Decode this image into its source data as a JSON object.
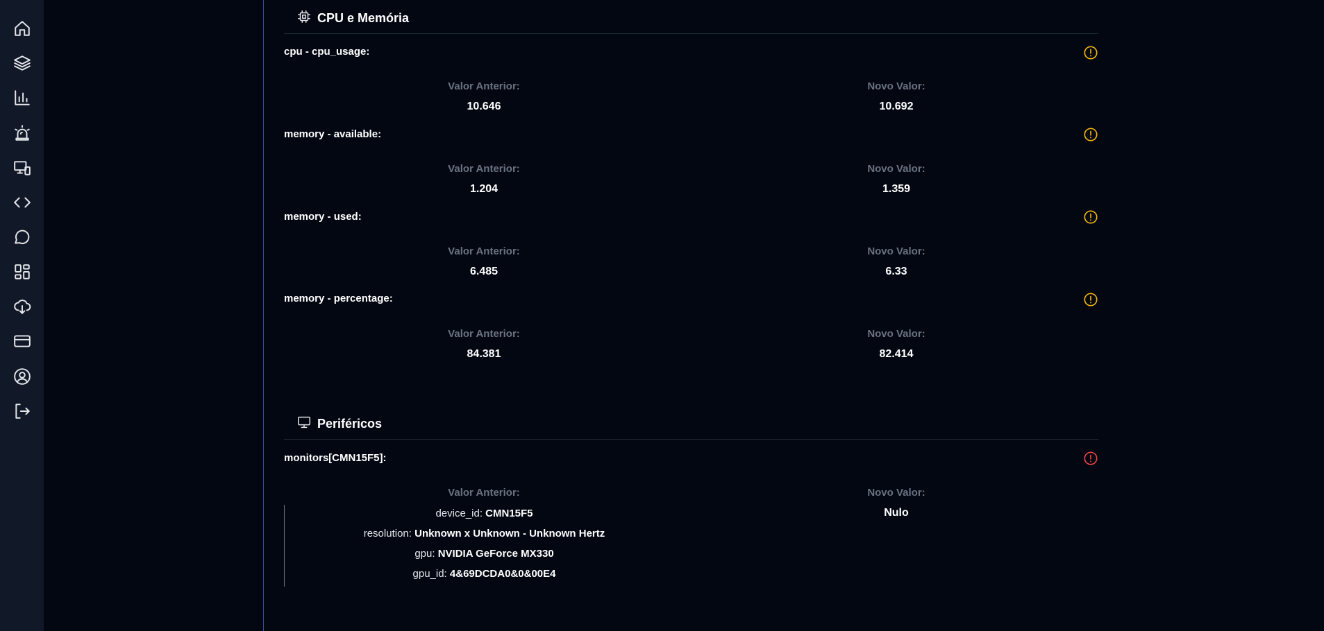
{
  "sidebar": {
    "items": [
      {
        "icon": "home-icon"
      },
      {
        "icon": "layers-icon"
      },
      {
        "icon": "bar-chart-icon"
      },
      {
        "icon": "alarm-siren-icon"
      },
      {
        "icon": "devices-icon"
      },
      {
        "icon": "code-icon"
      },
      {
        "icon": "chat-bubble-icon"
      },
      {
        "icon": "dashboard-grid-icon"
      },
      {
        "icon": "cloud-download-icon"
      },
      {
        "icon": "credit-card-icon"
      },
      {
        "icon": "user-circle-icon"
      },
      {
        "icon": "logout-icon"
      }
    ]
  },
  "colors": {
    "background": "#030712",
    "sidebar": "#111827",
    "warning": "#f5b70a",
    "error": "#ef4444",
    "muted": "#6b7280"
  },
  "cpu_section": {
    "title": "CPU e Memória",
    "metrics": [
      {
        "label": "cpu - cpu_usage:",
        "status": "warning",
        "prev_title": "Valor Anterior:",
        "prev_value": "10.646",
        "new_title": "Novo Valor:",
        "new_value": "10.692"
      },
      {
        "label": "memory - available:",
        "status": "warning",
        "prev_title": "Valor Anterior:",
        "prev_value": "1.204",
        "new_title": "Novo Valor:",
        "new_value": "1.359"
      },
      {
        "label": "memory - used:",
        "status": "warning",
        "prev_title": "Valor Anterior:",
        "prev_value": "6.485",
        "new_title": "Novo Valor:",
        "new_value": "6.33"
      },
      {
        "label": "memory - percentage:",
        "status": "warning",
        "prev_title": "Valor Anterior:",
        "prev_value": "84.381",
        "new_title": "Novo Valor:",
        "new_value": "82.414"
      }
    ]
  },
  "peripherals_section": {
    "title": "Periféricos",
    "metric": {
      "label": "monitors[CMN15F5]:",
      "status": "error",
      "prev_title": "Valor Anterior:",
      "prev_lines": [
        {
          "key": "device_id:",
          "value": "CMN15F5"
        },
        {
          "key": "resolution:",
          "value": "Unknown x Unknown - Unknown Hertz"
        },
        {
          "key": "gpu:",
          "value": "NVIDIA GeForce MX330"
        },
        {
          "key": "gpu_id:",
          "value": "4&69DCDA0&0&00E4"
        }
      ],
      "new_title": "Novo Valor:",
      "new_value": "Nulo"
    }
  }
}
